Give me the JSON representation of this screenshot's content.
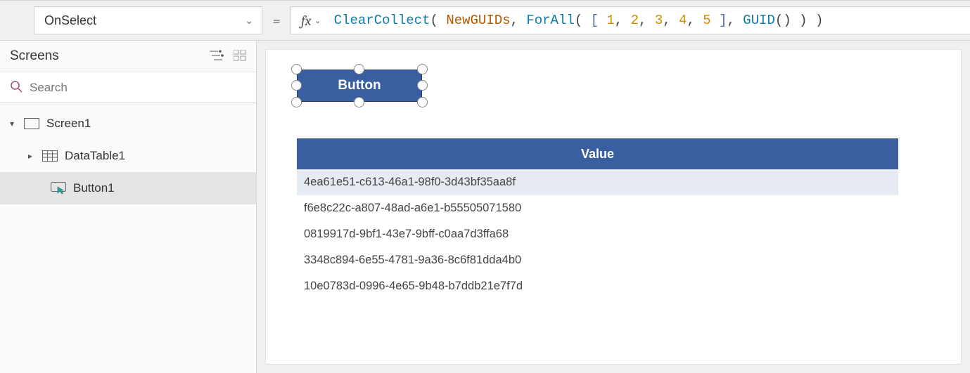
{
  "property_selector": {
    "value": "OnSelect"
  },
  "formula_bar": {
    "fx_label": "fx",
    "tokens": {
      "clearcollect": "ClearCollect",
      "open1": "(",
      "space": " ",
      "var": "NewGUIDs",
      "comma": ",",
      "forall": "ForAll",
      "open2": "(",
      "obrk": "[",
      "n1": "1",
      "n2": "2",
      "n3": "3",
      "n4": "4",
      "n5": "5",
      "cbrk": "]",
      "guid": "GUID",
      "close": ")"
    }
  },
  "sidebar": {
    "title": "Screens",
    "search_placeholder": "Search",
    "tree": {
      "screen1": "Screen1",
      "datatable1": "DataTable1",
      "button1": "Button1"
    }
  },
  "canvas": {
    "button_text": "Button"
  },
  "datatable": {
    "header": "Value",
    "rows": [
      "4ea61e51-c613-46a1-98f0-3d43bf35aa8f",
      "f6e8c22c-a807-48ad-a6e1-b55505071580",
      "0819917d-9bf1-43e7-9bff-c0aa7d3ffa68",
      "3348c894-6e55-4781-9a36-8c6f81dda4b0",
      "10e0783d-0996-4e65-9b48-b7ddb21e7f7d"
    ]
  }
}
